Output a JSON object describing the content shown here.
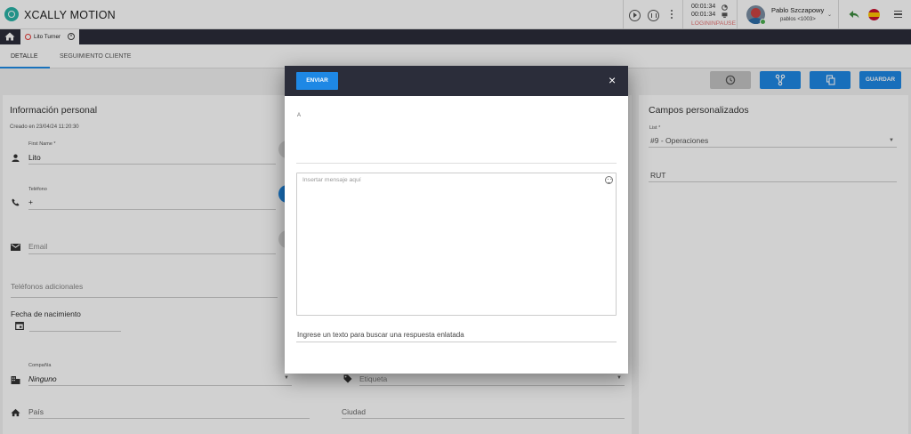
{
  "app": {
    "title": "XCALLY MOTION"
  },
  "header": {
    "timer1": "00:01:34",
    "timer2": "00:01:34",
    "status": "LOGININPAUSE",
    "user_name": "Pablo Szczapowy",
    "user_ext": "pablos <1003>"
  },
  "tabs": {
    "contact_tab": "Lito Turner",
    "close_glyph": "×"
  },
  "subtabs": {
    "detalle": "DETALLE",
    "seguimiento": "SEGUIMIENTO CLIENTE"
  },
  "toolbar": {
    "guardar": "GUARDAR"
  },
  "personal": {
    "title": "Información personal",
    "created": "Creado en 23/04/24 11:20:30",
    "first_name_label": "First Name *",
    "first_name": "Lito",
    "phone_label": "Teléfono",
    "phone": "+",
    "email_placeholder": "Email",
    "extra_phones": "Teléfonos adicionales",
    "birthdate": "Fecha de nacimiento",
    "company_label": "Compañía",
    "company": "Ninguno",
    "tag_placeholder": "Etiqueta",
    "country_placeholder": "País",
    "city_placeholder": "Ciudad"
  },
  "custom": {
    "title": "Campos personalizados",
    "list_label": "List *",
    "list_value": "#9 - Operaciones",
    "rut_label": "RUT"
  },
  "modal": {
    "send": "ENVIAR",
    "close": "×",
    "to_label": "A",
    "message_placeholder": "Insertar mensaje aquí",
    "canned_search": "Ingrese un texto para buscar una respuesta enlatada"
  },
  "colors": {
    "accent": "#1e88e5",
    "dark": "#2b2d3a",
    "status": "#e57373",
    "brand": "#2ab3a7"
  }
}
